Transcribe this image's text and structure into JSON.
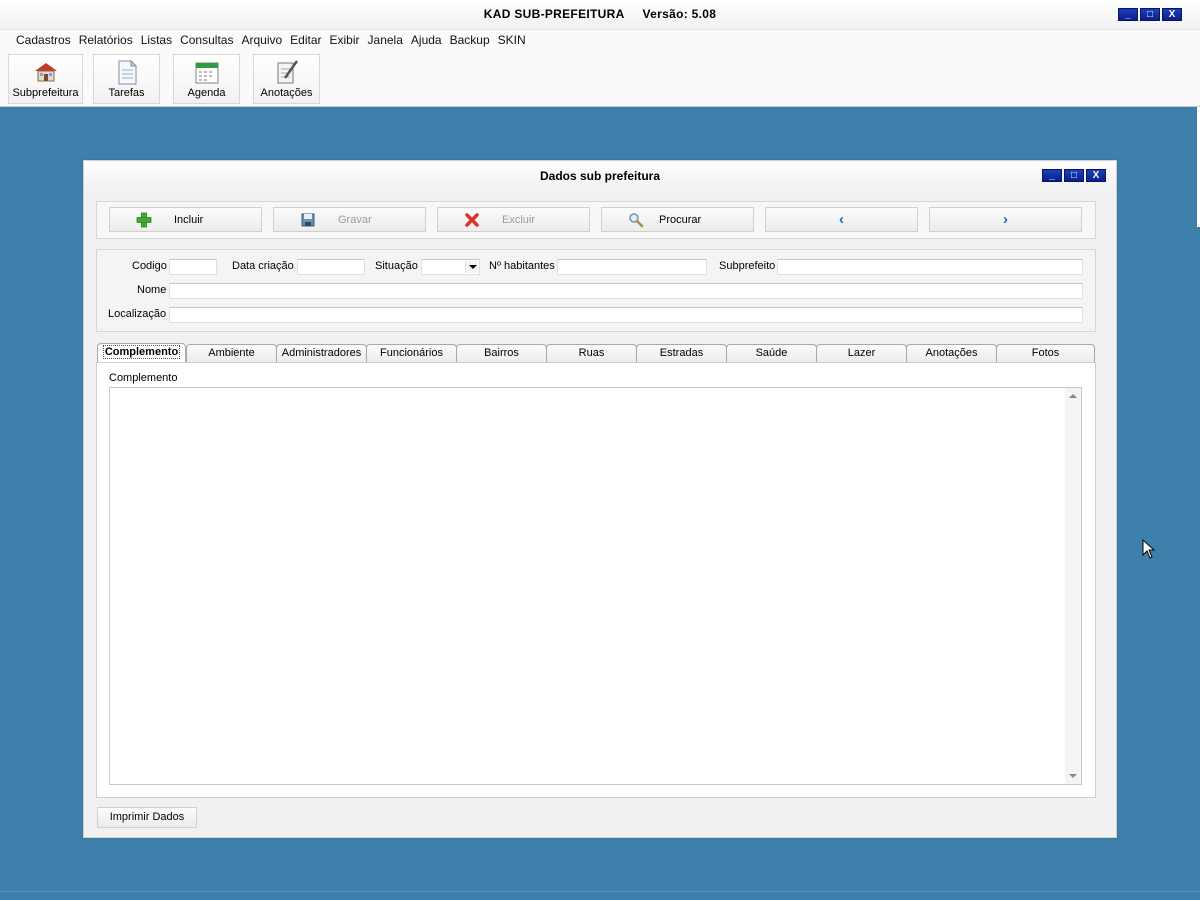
{
  "app": {
    "title": "KAD SUB-PREFEITURA",
    "version": "Versão: 5.08",
    "minimize_label": "_",
    "maximize_label": "□",
    "close_label": "X"
  },
  "menu": [
    "Cadastros",
    "Relatórios",
    "Listas",
    "Consultas",
    "Arquivo",
    "Editar",
    "Exibir",
    "Janela",
    "Ajuda",
    "Backup",
    "SKIN"
  ],
  "toolbar": {
    "buttons": [
      {
        "label": "Subprefeitura",
        "icon": "house-icon"
      },
      {
        "label": "Tarefas",
        "icon": "document-icon"
      },
      {
        "label": "Agenda",
        "icon": "calendar-icon"
      },
      {
        "label": "Anotações",
        "icon": "notepad-pen-icon"
      }
    ]
  },
  "dialog": {
    "title": "Dados sub prefeitura",
    "actions": {
      "incluir": "Incluir",
      "gravar": "Gravar",
      "excluir": "Excluir",
      "procurar": "Procurar",
      "prev": "‹",
      "next": "›"
    },
    "fields": {
      "codigo_label": "Codigo",
      "codigo_value": "",
      "data_criacao_label": "Data criação",
      "data_criacao_value": "",
      "situacao_label": "Situação",
      "situacao_value": "",
      "habitantes_label": "Nº habitantes",
      "habitantes_value": "",
      "subprefeito_label": "Subprefeito",
      "subprefeito_value": "",
      "nome_label": "Nome",
      "nome_value": "",
      "localizacao_label": "Localização",
      "localizacao_value": ""
    },
    "tabs": [
      "Complemento",
      "Ambiente",
      "Administradores",
      "Funcionários",
      "Bairros",
      "Ruas",
      "Estradas",
      "Saúde",
      "Lazer",
      "Anotações",
      "Fotos"
    ],
    "active_tab": "Complemento",
    "panel_label": "Complemento",
    "complemento_value": "",
    "print_button": "Imprimir Dados"
  },
  "colors": {
    "desktop": "#3d80ab",
    "window_button": "#0a1f8c",
    "incluir_icon": "#3cae2c",
    "excluir_icon": "#d8322a",
    "nav_arrow": "#1669c2"
  }
}
